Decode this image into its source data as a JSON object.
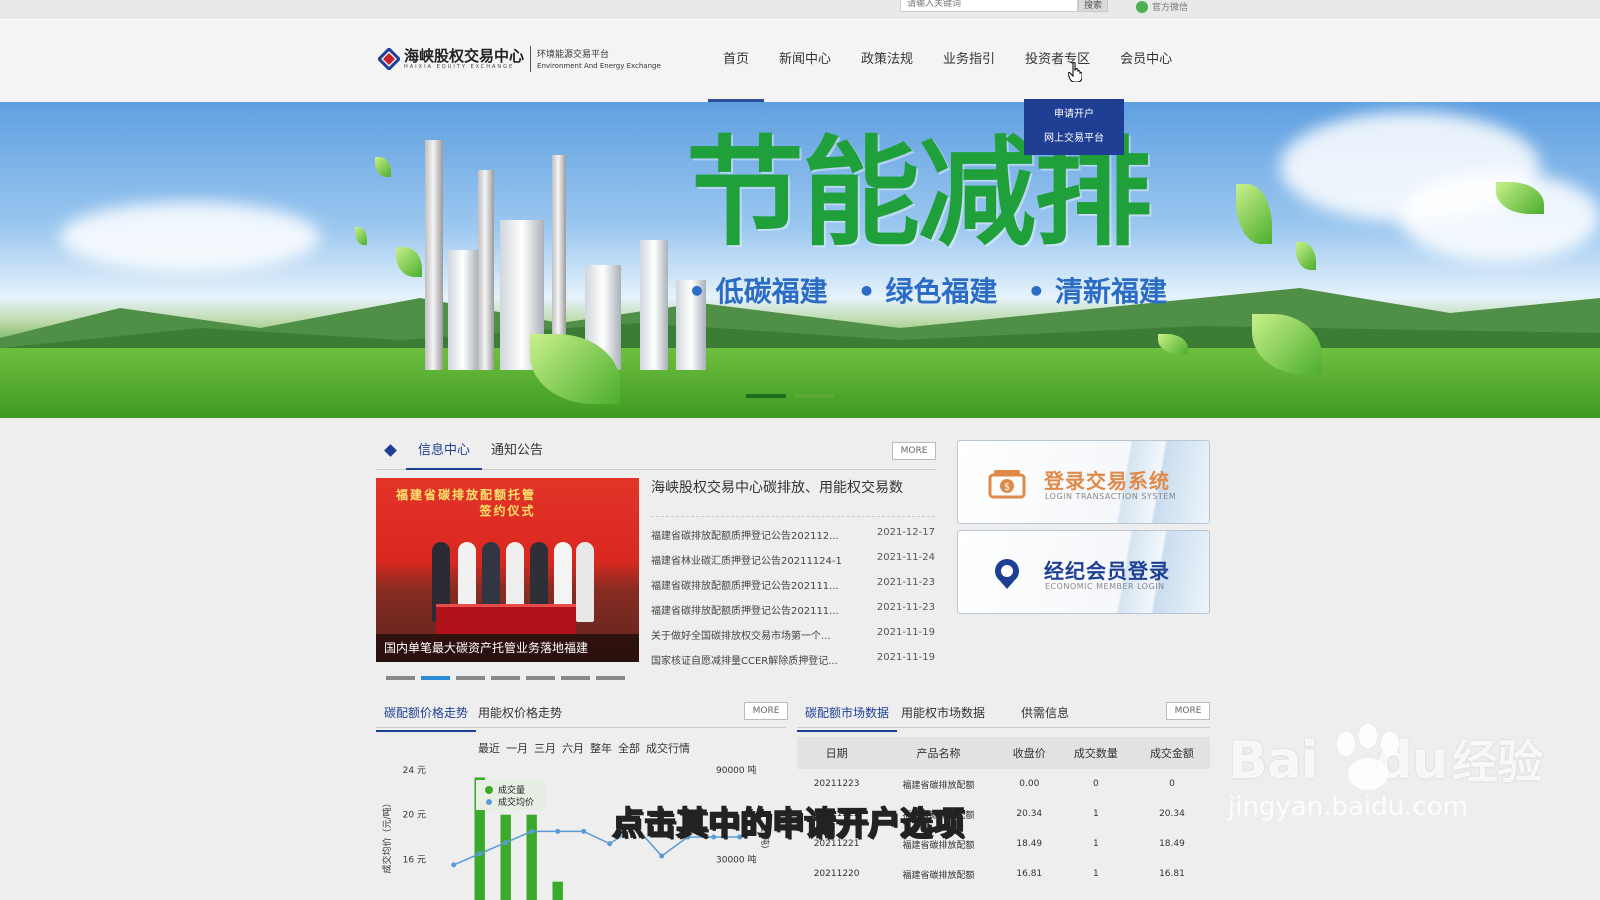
{
  "topbar": {
    "search_placeholder": "请输入关键词",
    "search_button": "搜索",
    "wechat_label": "官方微信"
  },
  "header": {
    "logo_name": "海峡股权交易中心",
    "logo_en": "HAIXIA EQUITY EXCHANGE",
    "platform_name": "环境能源交易平台",
    "platform_en": "Environment And Energy Exchange",
    "nav": [
      {
        "label": "首页"
      },
      {
        "label": "新闻中心"
      },
      {
        "label": "政策法规"
      },
      {
        "label": "业务指引"
      },
      {
        "label": "投资者专区"
      },
      {
        "label": "会员中心"
      }
    ],
    "active_nav": "首页",
    "dropdown": [
      {
        "label": "申请开户"
      },
      {
        "label": "网上交易平台"
      }
    ]
  },
  "banner": {
    "title": "节能减排",
    "slogans": [
      "低碳福建",
      "绿色福建",
      "清新福建"
    ],
    "slide_count": 2,
    "active_slide": 1
  },
  "info": {
    "tabs": [
      {
        "label": "信息中心"
      },
      {
        "label": "通知公告"
      }
    ],
    "active_tab": "信息中心",
    "more_label": "MORE",
    "photo_banner": "福建省碳排放配额托管",
    "photo_banner2": "签约仪式",
    "photo_caption": "国内单笔最大碳资产托管业务落地福建",
    "photo_slides": 7,
    "photo_active": 2,
    "headline": "海峡股权交易中心碳排放、用能权交易数",
    "news": [
      {
        "title": "福建省碳排放配额质押登记公告202112...",
        "date": "2021-12-17"
      },
      {
        "title": "福建省林业碳汇质押登记公告20211124-1",
        "date": "2021-11-24"
      },
      {
        "title": "福建省碳排放配额质押登记公告202111...",
        "date": "2021-11-23"
      },
      {
        "title": "福建省碳排放配额质押登记公告202111...",
        "date": "2021-11-23"
      },
      {
        "title": "关于做好全国碳排放权交易市场第一个...",
        "date": "2021-11-19"
      },
      {
        "title": "国家核证自愿减排量CCER解除质押登记...",
        "date": "2021-11-19"
      }
    ]
  },
  "side_buttons": [
    {
      "title": "登录交易系统",
      "subtitle": "LOGIN TRANSACTION SYSTEM",
      "color": "#e08a4a"
    },
    {
      "title": "经纪会员登录",
      "subtitle": "ECONOMIC MEMBER LOGIN",
      "color": "#1f3f94"
    }
  ],
  "price_trend": {
    "tabs": [
      {
        "label": "碳配额价格走势"
      },
      {
        "label": "用能权价格走势"
      }
    ],
    "active_tab": "碳配额价格走势",
    "more_label": "MORE",
    "filters": [
      "最近",
      "一月",
      "三月",
      "六月",
      "整年",
      "全部",
      "成交行情"
    ]
  },
  "chart_data": {
    "type": "bar",
    "left_ticks": [
      "24 元",
      "20 元",
      "16 元"
    ],
    "right_ticks": [
      "90000 吨",
      "30000 吨"
    ],
    "ylabel": "成交均价（元/吨）",
    "y2label": "量(吨)",
    "ylim": [
      12,
      24
    ],
    "y2lim": [
      0,
      90000
    ],
    "legend": [
      "成交量",
      "成交均价"
    ],
    "series": [
      {
        "name": "成交量",
        "type": "bar",
        "color": "#3aaa2a",
        "values": [
          0,
          85000,
          60000,
          60000,
          15000,
          0,
          0,
          0,
          0,
          2000,
          2000,
          1000
        ]
      },
      {
        "name": "成交均价",
        "type": "line",
        "color": "#5b9bd5",
        "values": [
          15.5,
          16.5,
          17.5,
          18.5,
          18.5,
          18.5,
          17.4,
          18.9,
          16.3,
          18.0,
          18.0,
          18.0
        ]
      }
    ]
  },
  "market": {
    "tabs": [
      {
        "label": "碳配额市场数据"
      },
      {
        "label": "用能权市场数据"
      },
      {
        "label": "供需信息"
      }
    ],
    "active_tab": "碳配额市场数据",
    "more_label": "MORE",
    "columns": [
      "日期",
      "产品名称",
      "收盘价",
      "成交数量",
      "成交金额"
    ],
    "rows": [
      [
        "20211223",
        "福建省碳排放配额",
        "0.00",
        "0",
        "0"
      ],
      [
        "20211222",
        "福建省碳排放配额",
        "20.34",
        "1",
        "20.34"
      ],
      [
        "20211221",
        "福建省碳排放配额",
        "18.49",
        "1",
        "18.49"
      ],
      [
        "20211220",
        "福建省碳排放配额",
        "16.81",
        "1",
        "16.81"
      ]
    ]
  },
  "overlay": {
    "subtitle": "点击其中的申请开户选项",
    "watermark_logo": "Bai",
    "watermark_logo2": "du",
    "watermark_cn": "经验",
    "watermark_url": "jingyan.baidu.com"
  }
}
